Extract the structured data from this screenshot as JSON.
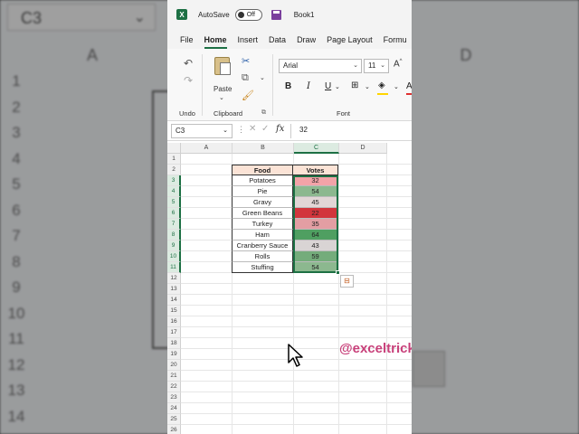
{
  "background": {
    "name_box": "C3",
    "col_a": "A",
    "col_d": "D",
    "rows": [
      "1",
      "2",
      "3",
      "4",
      "5",
      "6",
      "7",
      "8",
      "9",
      "10",
      "11",
      "12",
      "13",
      "14"
    ]
  },
  "titlebar": {
    "app_logo": "X",
    "autosave_label": "AutoSave",
    "toggle_state": "Off",
    "book_title": "Book1"
  },
  "tabs": [
    "File",
    "Home",
    "Insert",
    "Data",
    "Draw",
    "Page Layout",
    "Formu"
  ],
  "ribbon": {
    "undo_label": "Undo",
    "paste_label": "Paste",
    "clipboard_label": "Clipboard",
    "font_label": "Font",
    "font_name": "Arial",
    "font_size": "11",
    "bold": "B",
    "italic": "I",
    "underline": "U",
    "grow_font": "A",
    "fill_color": "#ffd500",
    "font_color": "#e03030"
  },
  "formula_bar": {
    "name_box": "C3",
    "fx": "fx",
    "value": "32"
  },
  "columns": [
    "A",
    "B",
    "C",
    "D"
  ],
  "row_numbers": [
    "1",
    "2",
    "3",
    "4",
    "5",
    "6",
    "7",
    "8",
    "9",
    "10",
    "11",
    "12",
    "13",
    "14",
    "15",
    "16",
    "17",
    "18",
    "19",
    "20",
    "21",
    "22",
    "23",
    "24",
    "25",
    "26"
  ],
  "table": {
    "headers": [
      "Food",
      "Votes"
    ],
    "rows": [
      {
        "food": "Potatoes",
        "votes": "32",
        "color": "#f3a3a8"
      },
      {
        "food": "Pie",
        "votes": "54",
        "color": "#8cb88f"
      },
      {
        "food": "Gravy",
        "votes": "45",
        "color": "#e2d6d6"
      },
      {
        "food": "Green Beans",
        "votes": "22",
        "color": "#d2353c"
      },
      {
        "food": "Turkey",
        "votes": "35",
        "color": "#e39ea3"
      },
      {
        "food": "Ham",
        "votes": "64",
        "color": "#4f9f61"
      },
      {
        "food": "Cranberry Sauce",
        "votes": "43",
        "color": "#d9d4d4"
      },
      {
        "food": "Rolls",
        "votes": "59",
        "color": "#74ac7b"
      },
      {
        "food": "Stuffing",
        "votes": "54",
        "color": "#8cb88f"
      }
    ]
  },
  "watermark": "@exceltrick"
}
